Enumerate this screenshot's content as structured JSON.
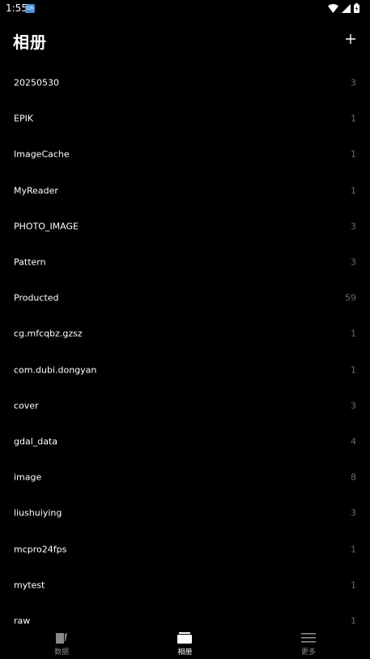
{
  "status_bar": {
    "time": "1:55",
    "app_icon_label": "GR"
  },
  "header": {
    "title": "相册",
    "add_icon": "plus-icon"
  },
  "albums": [
    {
      "name": "20250530",
      "count": "3"
    },
    {
      "name": "EPIK",
      "count": "1"
    },
    {
      "name": "ImageCache",
      "count": "1"
    },
    {
      "name": "MyReader",
      "count": "1"
    },
    {
      "name": "PHOTO_IMAGE",
      "count": "3"
    },
    {
      "name": "Pattern",
      "count": "3"
    },
    {
      "name": "Producted",
      "count": "59"
    },
    {
      "name": "cg.mfcqbz.gzsz",
      "count": "1"
    },
    {
      "name": "com.dubi.dongyan",
      "count": "1"
    },
    {
      "name": "cover",
      "count": "3"
    },
    {
      "name": "gdal_data",
      "count": "4"
    },
    {
      "name": "image",
      "count": "8"
    },
    {
      "name": "liushuiying",
      "count": "3"
    },
    {
      "name": "mcpro24fps",
      "count": "1"
    },
    {
      "name": "mytest",
      "count": "1"
    },
    {
      "name": "raw",
      "count": "1"
    }
  ],
  "bottom_nav": [
    {
      "label": "数据",
      "icon": "notebook-icon",
      "active": false
    },
    {
      "label": "相册",
      "icon": "album-icon",
      "active": true
    },
    {
      "label": "更多",
      "icon": "menu-icon",
      "active": false
    }
  ],
  "colors": {
    "background": "#000000",
    "text": "#ffffff",
    "count_text": "#6b6b6b",
    "nav_inactive": "#8a8a8a"
  }
}
